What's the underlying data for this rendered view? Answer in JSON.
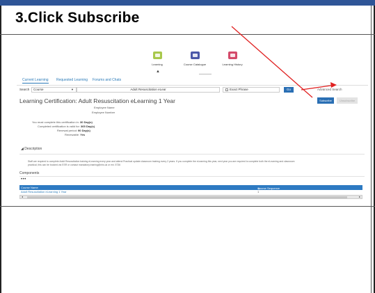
{
  "heading": "3.Click Subscribe",
  "colors": {
    "accent": "#2a6fb4",
    "annotation_arrow": "#e02020",
    "top_bar": "#2f5597"
  },
  "apps": [
    {
      "label": "Learning",
      "color": "#a8c84c",
      "icon": "learning-icon"
    },
    {
      "label": "Course Catalogue",
      "color": "#4a57a8",
      "icon": "catalogue-icon"
    },
    {
      "label": "Learning History",
      "color": "#d44a6a",
      "icon": "history-icon"
    }
  ],
  "tabs": [
    "Current Learning",
    "Requested Learning",
    "Forums and Chats"
  ],
  "search": {
    "label": "Search",
    "scope": "Course",
    "query": "Adult Resuscitation eLear",
    "exact_phrase": "Exact Phrase",
    "go": "Go",
    "advanced": "Advanced Search"
  },
  "page": {
    "title": "Learning Certification: Adult Resuscitation eLearning 1 Year",
    "subscribe": "Subscribe",
    "unsubscribe": "Unsubscribe",
    "employee_name": "Employee Name",
    "employee_number": "Employee Number",
    "fields": [
      {
        "label": "You must complete this certification in:",
        "value": "30",
        "unit": "Day(s)"
      },
      {
        "label": "Completed certification is valid for:",
        "value": "365",
        "unit": "Day(s)"
      },
      {
        "label": "Renewal period:",
        "value": "90",
        "unit": "Day(s)"
      },
      {
        "label": "Renewable:",
        "value": "Yes",
        "unit": ""
      }
    ]
  },
  "description": {
    "heading": "Description",
    "line1": "Staff are required to complete Adult Resuscitation training eLearning every year and attend Practical update classroom training every 2 years. If you complete the eLearning this year, next year you are required to complete both the eLearning and classroom",
    "line2": "practical, this can be booked via ESR or contact mandatory.training@nhs.uk or ext. 5736"
  },
  "components": {
    "heading": "Components",
    "dots": "•••",
    "columns": [
      "Course Name",
      "Course Sequence"
    ],
    "sort_indicator": "▲",
    "rows": [
      {
        "name": "Adult Resuscitation eLearning 1 Year",
        "sequence": "1"
      }
    ]
  }
}
